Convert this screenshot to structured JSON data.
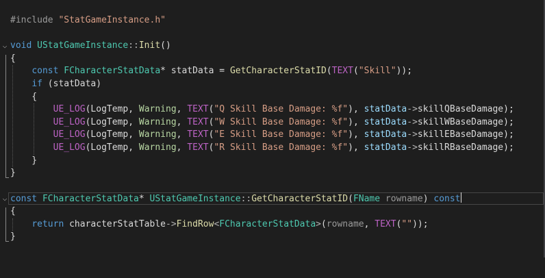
{
  "editor": {
    "lines": [
      [
        {
          "t": "#include ",
          "c": "pp"
        },
        {
          "t": "\"StatGameInstance.h\"",
          "c": "str"
        }
      ],
      [],
      [
        {
          "t": "void",
          "c": "kw"
        },
        {
          "t": " "
        },
        {
          "t": "UStatGameInstance",
          "c": "ty"
        },
        {
          "t": "::",
          "c": "op"
        },
        {
          "t": "Init",
          "c": "fn"
        },
        {
          "t": "()"
        }
      ],
      [
        {
          "t": "{"
        }
      ],
      [
        {
          "t": "    "
        },
        {
          "t": "const",
          "c": "kw"
        },
        {
          "t": " "
        },
        {
          "t": "FCharacterStatData",
          "c": "ty"
        },
        {
          "t": "* "
        },
        {
          "t": "statData",
          "c": "fld"
        },
        {
          "t": " = "
        },
        {
          "t": "GetCharacterStatID",
          "c": "fn"
        },
        {
          "t": "("
        },
        {
          "t": "TEXT",
          "c": "mac"
        },
        {
          "t": "("
        },
        {
          "t": "\"Skill\"",
          "c": "str"
        },
        {
          "t": "));"
        }
      ],
      [
        {
          "t": "    "
        },
        {
          "t": "if",
          "c": "kw"
        },
        {
          "t": " ("
        },
        {
          "t": "statData",
          "c": "fld"
        },
        {
          "t": ")"
        }
      ],
      [
        {
          "t": "    {"
        }
      ],
      [
        {
          "t": "        "
        },
        {
          "t": "UE_LOG",
          "c": "mac"
        },
        {
          "t": "("
        },
        {
          "t": "LogTemp",
          "c": "fld"
        },
        {
          "t": ", "
        },
        {
          "t": "Warning",
          "c": "en"
        },
        {
          "t": ", "
        },
        {
          "t": "TEXT",
          "c": "mac"
        },
        {
          "t": "("
        },
        {
          "t": "\"Q Skill Base Damage: %f\"",
          "c": "str"
        },
        {
          "t": "), "
        },
        {
          "t": "statData",
          "c": "var"
        },
        {
          "t": "->",
          "c": "op"
        },
        {
          "t": "skillQBaseDamage",
          "c": "fld"
        },
        {
          "t": ");"
        }
      ],
      [
        {
          "t": "        "
        },
        {
          "t": "UE_LOG",
          "c": "mac"
        },
        {
          "t": "("
        },
        {
          "t": "LogTemp",
          "c": "fld"
        },
        {
          "t": ", "
        },
        {
          "t": "Warning",
          "c": "en"
        },
        {
          "t": ", "
        },
        {
          "t": "TEXT",
          "c": "mac"
        },
        {
          "t": "("
        },
        {
          "t": "\"W Skill Base Damage: %f\"",
          "c": "str"
        },
        {
          "t": "), "
        },
        {
          "t": "statData",
          "c": "var"
        },
        {
          "t": "->",
          "c": "op"
        },
        {
          "t": "skillWBaseDamage",
          "c": "fld"
        },
        {
          "t": ");"
        }
      ],
      [
        {
          "t": "        "
        },
        {
          "t": "UE_LOG",
          "c": "mac"
        },
        {
          "t": "("
        },
        {
          "t": "LogTemp",
          "c": "fld"
        },
        {
          "t": ", "
        },
        {
          "t": "Warning",
          "c": "en"
        },
        {
          "t": ", "
        },
        {
          "t": "TEXT",
          "c": "mac"
        },
        {
          "t": "("
        },
        {
          "t": "\"E Skill Base Damage: %f\"",
          "c": "str"
        },
        {
          "t": "), "
        },
        {
          "t": "statData",
          "c": "var"
        },
        {
          "t": "->",
          "c": "op"
        },
        {
          "t": "skillEBaseDamage",
          "c": "fld"
        },
        {
          "t": ");"
        }
      ],
      [
        {
          "t": "        "
        },
        {
          "t": "UE_LOG",
          "c": "mac"
        },
        {
          "t": "("
        },
        {
          "t": "LogTemp",
          "c": "fld"
        },
        {
          "t": ", "
        },
        {
          "t": "Warning",
          "c": "en"
        },
        {
          "t": ", "
        },
        {
          "t": "TEXT",
          "c": "mac"
        },
        {
          "t": "("
        },
        {
          "t": "\"R Skill Base Damage: %f\"",
          "c": "str"
        },
        {
          "t": "), "
        },
        {
          "t": "statData",
          "c": "var"
        },
        {
          "t": "->",
          "c": "op"
        },
        {
          "t": "skillRBaseDamage",
          "c": "fld"
        },
        {
          "t": ");"
        }
      ],
      [
        {
          "t": "    }"
        }
      ],
      [
        {
          "t": "}"
        }
      ],
      [],
      [
        {
          "t": "const",
          "c": "kw"
        },
        {
          "t": " "
        },
        {
          "t": "FCharacterStatData",
          "c": "ty"
        },
        {
          "t": "* "
        },
        {
          "t": "UStatGameInstance",
          "c": "ty"
        },
        {
          "t": "::",
          "c": "op"
        },
        {
          "t": "GetCharacterStatID",
          "c": "fn"
        },
        {
          "t": "("
        },
        {
          "t": "FName",
          "c": "ty"
        },
        {
          "t": " "
        },
        {
          "t": "rowname",
          "c": "prm"
        },
        {
          "t": ") "
        },
        {
          "t": "const",
          "c": "kw"
        }
      ],
      [
        {
          "t": "{"
        }
      ],
      [
        {
          "t": "    "
        },
        {
          "t": "return",
          "c": "kw"
        },
        {
          "t": " "
        },
        {
          "t": "characterStatTable",
          "c": "fld"
        },
        {
          "t": "->",
          "c": "op"
        },
        {
          "t": "FindRow",
          "c": "fn"
        },
        {
          "t": "<",
          "c": "op"
        },
        {
          "t": "FCharacterStatData",
          "c": "ty"
        },
        {
          "t": ">",
          "c": "op"
        },
        {
          "t": "("
        },
        {
          "t": "rowname",
          "c": "prm"
        },
        {
          "t": ", "
        },
        {
          "t": "TEXT",
          "c": "mac"
        },
        {
          "t": "("
        },
        {
          "t": "\"\"",
          "c": "str"
        },
        {
          "t": "));"
        }
      ],
      [
        {
          "t": "}"
        }
      ]
    ],
    "collapse_glyph": "⌵",
    "colors": {
      "background": "#1e1e1e",
      "keyword": "#569cd6",
      "string": "#d69d85",
      "type": "#4ec9b0",
      "function": "#dcdcaa",
      "macro": "#bd63c5",
      "enum": "#b8d7a3",
      "variable": "#9cdcfe",
      "parameter": "#9a9a9a",
      "text": "#dcdcdc"
    }
  }
}
